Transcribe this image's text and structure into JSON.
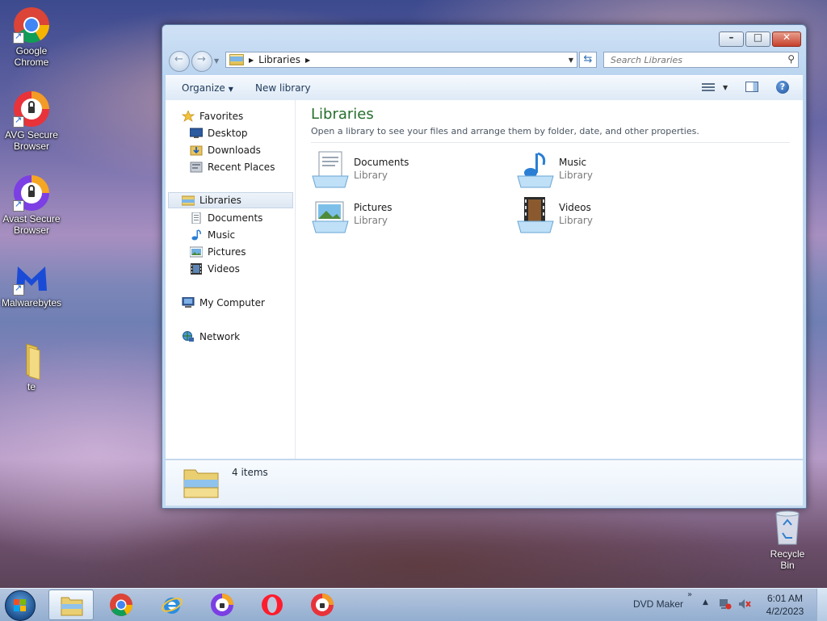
{
  "desktop": {
    "icons": [
      {
        "label": "Google Chrome"
      },
      {
        "label": "AVG Secure Browser"
      },
      {
        "label": "Avast Secure Browser"
      },
      {
        "label": "Malwarebytes"
      },
      {
        "label": "te"
      }
    ],
    "recycle_bin": "Recycle Bin"
  },
  "window": {
    "address": {
      "location": "Libraries"
    },
    "search": {
      "placeholder": "Search Libraries"
    },
    "toolbar": {
      "organize": "Organize",
      "new_library": "New library"
    },
    "nav": {
      "favorites": "Favorites",
      "desktop": "Desktop",
      "downloads": "Downloads",
      "recent_places": "Recent Places",
      "libraries": "Libraries",
      "documents": "Documents",
      "music": "Music",
      "pictures": "Pictures",
      "videos": "Videos",
      "my_computer": "My Computer",
      "network": "Network"
    },
    "main": {
      "title": "Libraries",
      "description": "Open a library to see your files and arrange them by folder, date, and other properties.",
      "items": [
        {
          "name": "Documents",
          "kind": "Library"
        },
        {
          "name": "Music",
          "kind": "Library"
        },
        {
          "name": "Pictures",
          "kind": "Library"
        },
        {
          "name": "Videos",
          "kind": "Library"
        }
      ]
    },
    "details": {
      "count": "4 items"
    }
  },
  "taskbar": {
    "tray_label": "DVD Maker",
    "time": "6:01 AM",
    "date": "4/2/2023"
  },
  "colors": {
    "title_green": "#266d2c",
    "selection": "#dde7f2",
    "taskbar": "#a9c2df"
  }
}
